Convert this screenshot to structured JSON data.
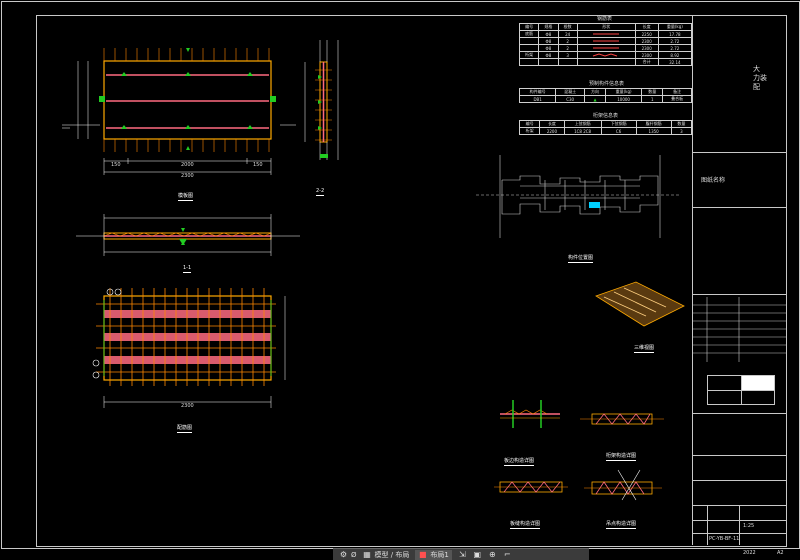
{
  "title_block": {
    "logo_chars": [
      "大",
      "力装",
      "配"
    ],
    "project_title": "图纸名称",
    "drawing_no": "PC-YB-BF-11",
    "scale": "1:25",
    "year": "2022",
    "page": "A2"
  },
  "table1": {
    "title": "钢筋表",
    "headers": [
      "编号",
      "规格",
      "根数",
      "形状",
      "长度",
      "重量(kg)"
    ],
    "rows": [
      [
        "底筋",
        "Φ8",
        "24",
        "",
        "2250",
        "17.78"
      ],
      [
        "",
        "Φ8",
        "2",
        "",
        "2300",
        "2.72"
      ],
      [
        "",
        "Φ8",
        "2",
        "",
        "2300",
        "2.72"
      ],
      [
        "桁架",
        "Φ8",
        "3",
        "",
        "2300",
        "8.92"
      ],
      [
        "",
        "",
        "",
        "",
        "合计",
        "32.14"
      ]
    ]
  },
  "table2": {
    "title": "预制构件信息表",
    "headers": [
      "构件编号",
      "混凝土",
      "方向",
      "重量(kg)",
      "数量",
      "备注"
    ],
    "rows": [
      [
        "DB1",
        "C30",
        "",
        "10000",
        "1",
        "叠合板"
      ]
    ]
  },
  "table3": {
    "title": "桁架信息表",
    "headers": [
      "编号",
      "长度",
      "上弦钢筋",
      "下弦钢筋",
      "腹杆钢筋",
      "数量"
    ],
    "rows": [
      [
        "桁架",
        "2200",
        "1C8 2C8",
        "C6",
        "1350",
        "3"
      ]
    ]
  },
  "labels": {
    "plan_caption": "模板图",
    "section_11": "1-1",
    "section_22": "2-2",
    "rebar_caption": "配筋图",
    "keyplan_caption": "构件位置图",
    "iso_caption": "三维视图",
    "detail1": "板边构造详图",
    "detail2": "桁架构造详图",
    "detail3": "板缝构造详图",
    "detail4": "吊点构造详图",
    "dim_total": "2300",
    "dim_mid": "2000",
    "dim_side": "150"
  },
  "taskbar": {
    "items": [
      {
        "icon": "gear-icon",
        "label": "Ø"
      },
      {
        "icon": "layers-icon",
        "label": "模型 / 布局"
      },
      {
        "icon": "file-icon",
        "label": "布局1"
      }
    ]
  },
  "colors": {
    "background": "#000000",
    "frame": "#c8c8c8",
    "rebar": "#ff8800",
    "hatch": "#ff6b80",
    "dims": "#ffffff",
    "marker": "#00d0ff",
    "green": "#22cc22"
  }
}
